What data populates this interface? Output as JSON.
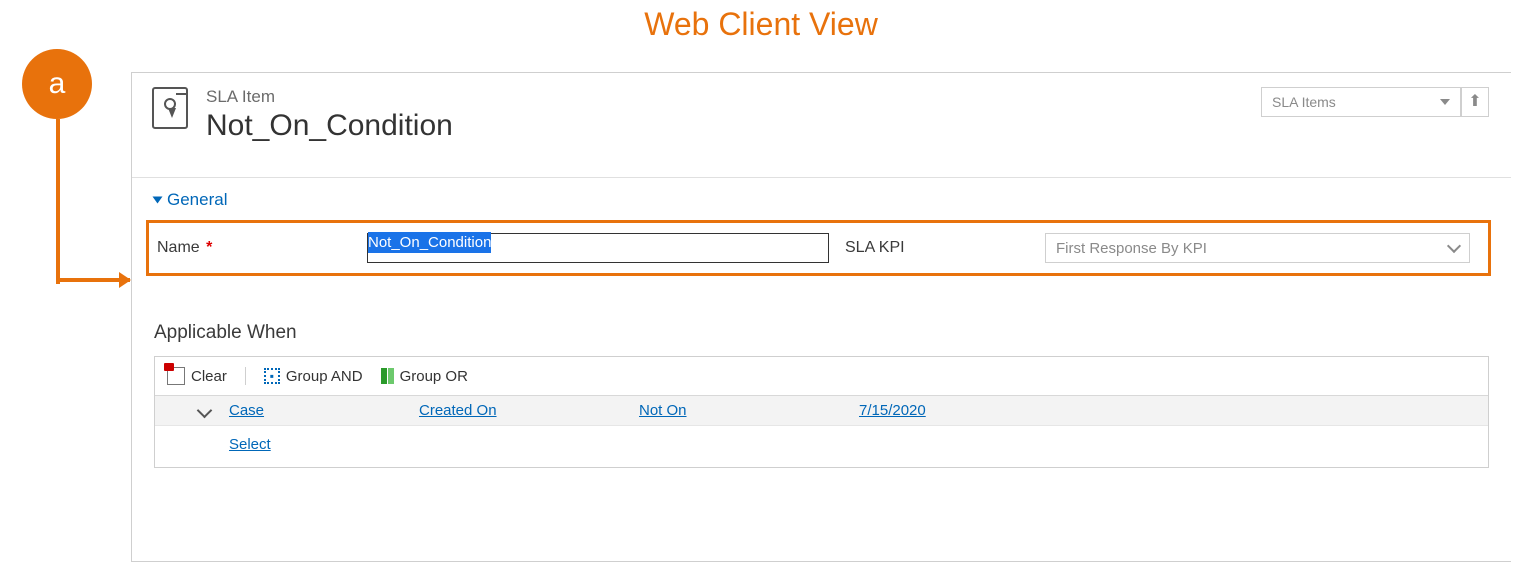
{
  "page_title": "Web Client View",
  "annotation": {
    "badge_letter": "a"
  },
  "view_picker": {
    "label": "SLA Items"
  },
  "header": {
    "entity_name": "SLA Item",
    "record_title": "Not_On_Condition"
  },
  "sections": {
    "general_label": "General",
    "applicable_when_label": "Applicable When"
  },
  "fields": {
    "name_label": "Name",
    "name_required_marker": "*",
    "name_value": "Not_On_Condition",
    "sla_kpi_label": "SLA KPI",
    "sla_kpi_value": "First Response By KPI"
  },
  "condition_toolbar": {
    "clear": "Clear",
    "group_and": "Group AND",
    "group_or": "Group OR"
  },
  "condition_row": {
    "entity": "Case",
    "attribute": "Created On",
    "operator": "Not On",
    "value": "7/15/2020"
  },
  "condition_select": "Select"
}
